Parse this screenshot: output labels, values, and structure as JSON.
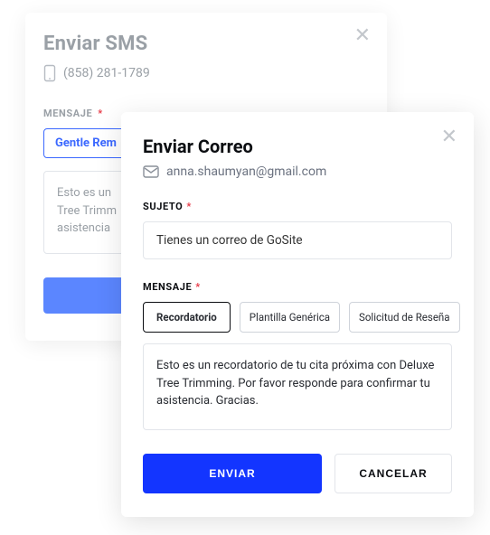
{
  "sms": {
    "title": "Enviar SMS",
    "phone": "(858) 281-1789",
    "message_label": "MENSAJE",
    "template_selected": "Gentle Rem",
    "message_value": "Esto es un\nTree Trimm\nasistencia"
  },
  "email": {
    "title": "Enviar Correo",
    "address": "anna.shaumyan@gmail.com",
    "subject_label": "SUJETO",
    "subject_value": "Tienes un correo de GoSite",
    "message_label": "MENSAJE",
    "templates": [
      {
        "label": "Recordatorio",
        "active": true
      },
      {
        "label": "Plantilla Genérica",
        "active": false
      },
      {
        "label": "Solicitud de Reseña",
        "active": false
      }
    ],
    "message_value": "Esto es un recordatorio de tu cita próxima con Deluxe Tree Trimming. Por favor responde para confirmar tu asistencia. Gracias.",
    "send_label": "ENVIAR",
    "cancel_label": "CANCELAR"
  }
}
